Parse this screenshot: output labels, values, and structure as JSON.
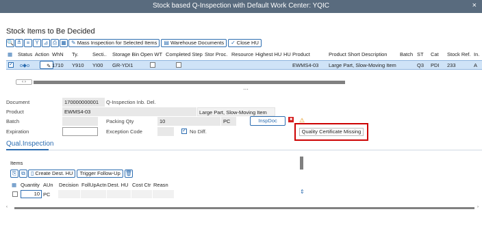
{
  "window": {
    "title": "Stock based Q-Inspection with Default Work Center: YQIC",
    "close_label": "×"
  },
  "section_title": "Stock Items to Be Decided",
  "toolbar": {
    "icons": [
      "🔍",
      "≜",
      "≡",
      "Y",
      "⊿",
      "⎙",
      "▦"
    ],
    "mass_inspection_label": "Mass Inspection for Selected Items",
    "warehouse_documents_label": "Warehouse Documents",
    "close_hu_label": "Close HU"
  },
  "grid": {
    "columns": [
      "Status",
      "Action",
      "WhN",
      "Ty.",
      "Secti..",
      "Storage Bin",
      "Open WT",
      "Completed Step",
      "Stor Proc.",
      "Resource",
      "Highest HU",
      "HU",
      "Product",
      "Product Short Description",
      "Batch",
      "ST",
      "Cat",
      "Stock Ref.",
      "In."
    ],
    "row": {
      "status": "o◆o",
      "whn": "1710",
      "ty": "Y910",
      "secti": "YI00",
      "storage_bin": "GR-YDI1",
      "product": "EWMS4-03",
      "product_desc": "Large Part, Slow-Moving Item",
      "st": "Q3",
      "cat": "PDI",
      "stock_ref": "233",
      "in": "A"
    }
  },
  "scroll": {
    "arrows": "‹ ›",
    "splitter": "⋯"
  },
  "form": {
    "document_label": "Document",
    "document_value": "170000000001",
    "document_desc": "Q-Inspection Inb. Del.",
    "product_label": "Product",
    "product_value": "EWMS4-03",
    "product_desc": "Large Part, Slow-Moving Item",
    "batch_label": "Batch",
    "packing_qty_label": "Packing Qty",
    "packing_qty_value": "10",
    "packing_unit": "PC",
    "inspdoc_label": "InspDoc",
    "expiration_label": "Expiration",
    "exception_code_label": "Exception Code",
    "no_diff_label": "No Diff.",
    "quality_cert_label": "Quality Certificate Missing"
  },
  "tab": {
    "label": "Qual.Inspection"
  },
  "items": {
    "label": "Items",
    "create_dest_hu_label": "Create Dest. HU",
    "trigger_followup_label": "Trigger Follow-Up",
    "columns": [
      "Quantity",
      "AUn",
      "Decision",
      "FollUpActn",
      "Dest. HU",
      "Cost Ctr",
      "Reasn"
    ],
    "row": {
      "quantity": "10",
      "aun": "PC"
    }
  },
  "colors": {
    "titlebar": "#596b7e",
    "accent": "#2b6cb0",
    "selected_row": "#cfe3f7",
    "highlight_box": "#cc0000"
  }
}
